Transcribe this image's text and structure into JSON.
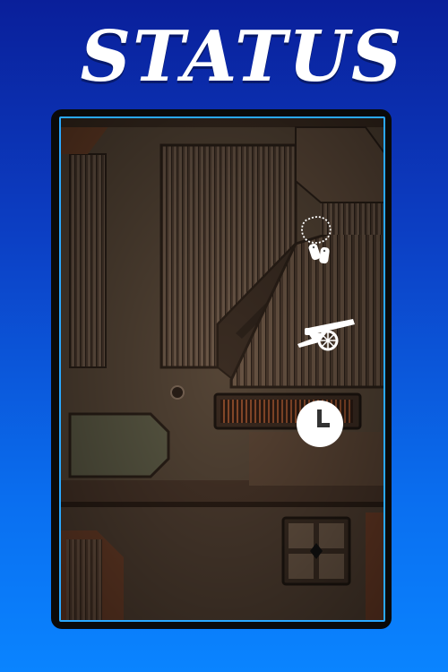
{
  "header": {
    "title": "STATUS"
  },
  "panel": {
    "icons": [
      {
        "name": "dog-tags-icon"
      },
      {
        "name": "cannon-icon"
      },
      {
        "name": "clock-icon"
      }
    ]
  },
  "colors": {
    "background_top": "#0a1f9a",
    "background_bottom": "#0a84ff",
    "panel_border": "#2aa8ff",
    "metal": "#5a4838",
    "rust": "#7a4a2c"
  }
}
